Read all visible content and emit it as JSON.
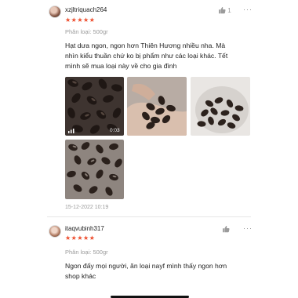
{
  "reviews": [
    {
      "username": "xzjltriquach264",
      "stars": "★★★★★",
      "variant": "Phân loại: 500gr",
      "likes": "1",
      "more": "···",
      "comment": [
        "Hạt dưa ngon, ngon hơn Thiên Hương nhiều nha. Mà",
        "nhìn kiểu thuần chứ ko bị phẩm như các loại khác. Tết",
        "mình sẽ mua loại này về cho gia đình"
      ],
      "video_duration": "0:03",
      "timestamp": "15-12-2022 10:19"
    },
    {
      "username": "itaqvubinh317",
      "stars": "★★★★★",
      "variant": "Phân loại: 500gr",
      "more": "···",
      "comment": [
        "Ngon đấy mọi người, ăn loại nayf mình thấy ngon hơn",
        "shop khác"
      ]
    }
  ],
  "colors": {
    "star": "#ee4d2d",
    "muted": "#9b9b9b",
    "text": "#222222"
  }
}
